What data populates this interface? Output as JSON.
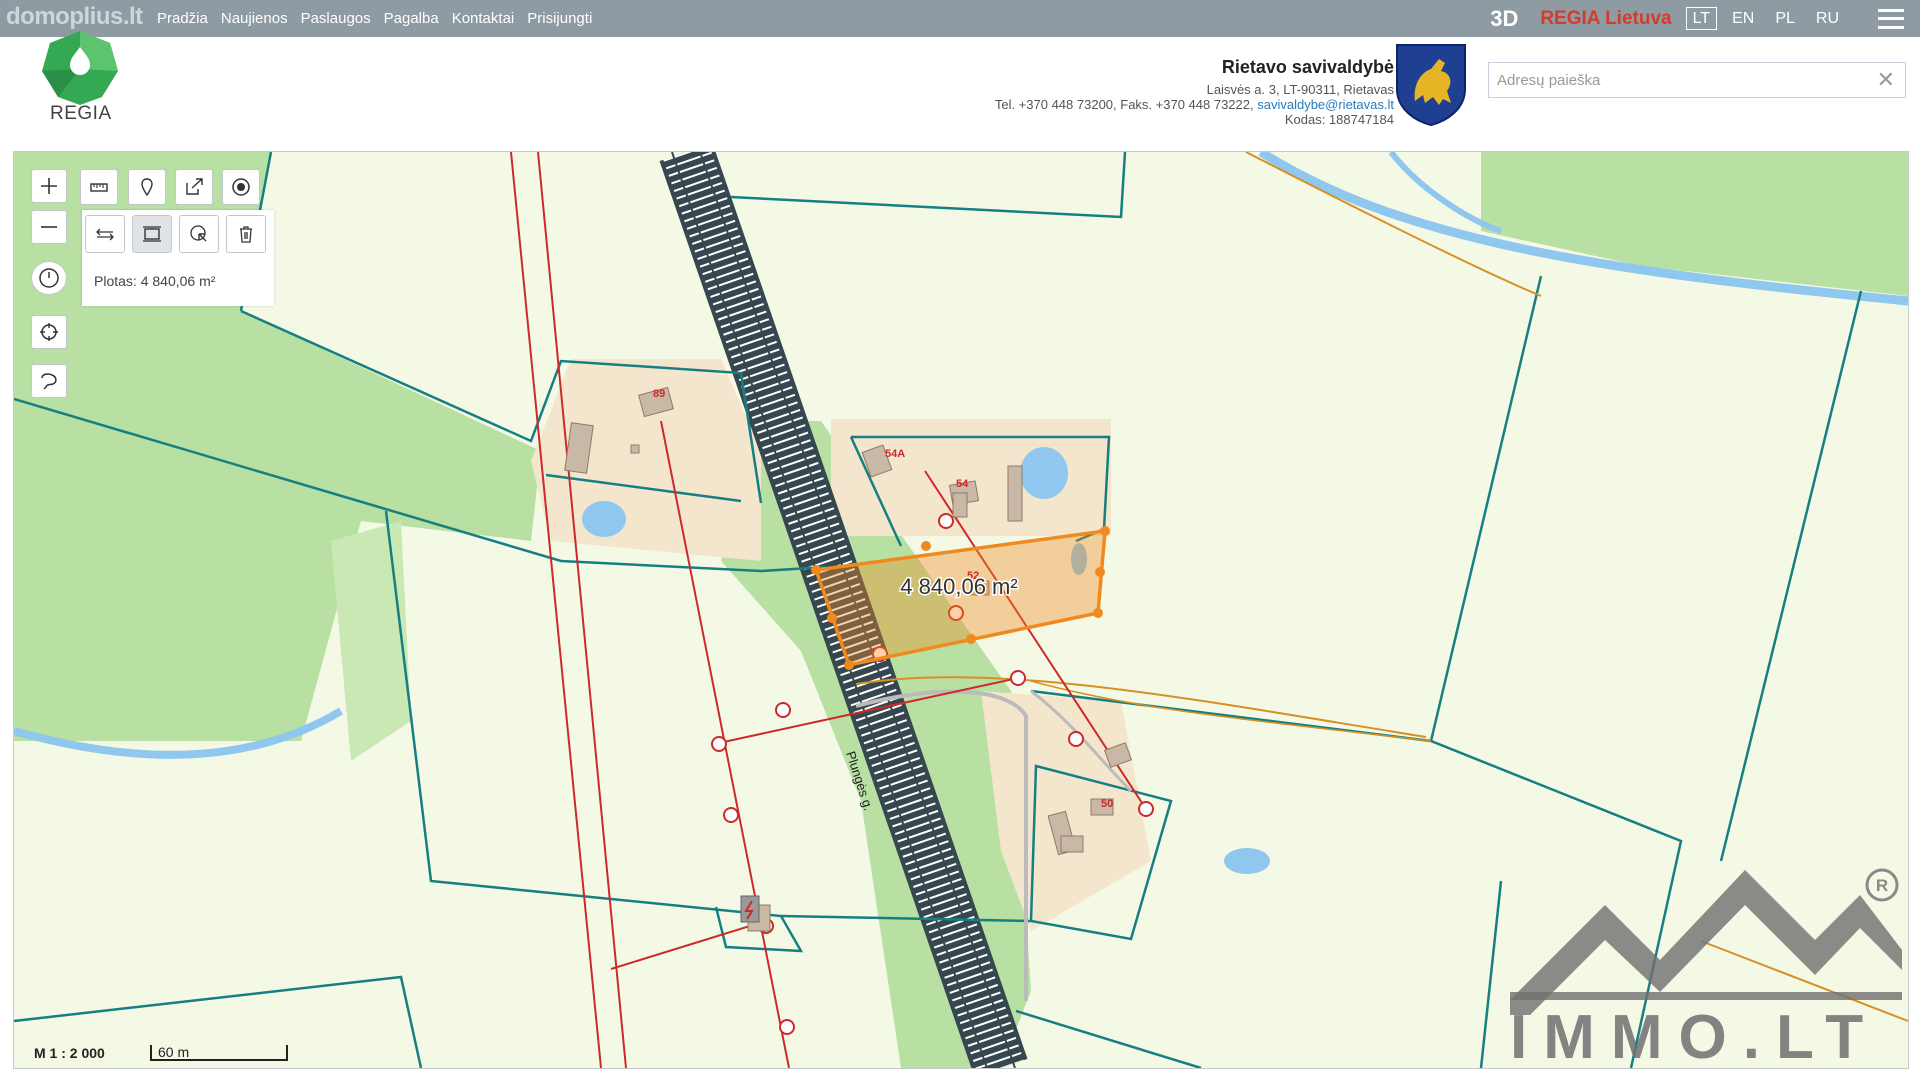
{
  "watermark": "domoplius.lt",
  "nav": {
    "items": [
      "Pradžia",
      "Naujienos",
      "Paslaugos",
      "Pagalba",
      "Kontaktai",
      "Prisijungti"
    ],
    "btn3d": "3D",
    "regia_lietuva": "REGIA Lietuva",
    "langs": [
      "LT",
      "EN",
      "PL",
      "RU"
    ],
    "active_lang": "LT"
  },
  "header": {
    "logo_text": "REGIA",
    "municipality": "Rietavo savivaldybė",
    "address": "Laisvės a. 3, LT-90311, Rietavas",
    "phone_fax": "Tel. +370 448 73200, Faks. +370 448 73222,",
    "email": "savivaldybe@rietavas.lt",
    "code": "Kodas: 188747184"
  },
  "search": {
    "placeholder": "Adresų paieška",
    "value": "",
    "clear_icon": "close-icon"
  },
  "map": {
    "tools": {
      "zoom_in": "plus-icon",
      "zoom_out": "minus-icon",
      "history": "clock-icon",
      "locate": "crosshair-icon",
      "lasso": "lasso-icon",
      "measure_ruler": "ruler-icon",
      "marker": "marker-icon",
      "share": "share-icon",
      "record": "record-icon",
      "measure_distance": "distance-icon",
      "measure_area": "area-icon",
      "pointer": "pointer-icon",
      "delete": "trash-icon"
    },
    "area_readout": "Plotas: 4 840,06 m²",
    "polygon_label": "4 840,06 m²",
    "parcel_labels": [
      "89",
      "54A",
      "54",
      "52",
      "50"
    ],
    "road_label": "Plungės g.",
    "scale_ratio": "M 1 : 2 000",
    "scale_bar": "60 m",
    "colors": {
      "field": "#f4f9e6",
      "forest": "#b8e0a3",
      "parcel": "#167f82",
      "polygon": "#f08a1f",
      "water": "#8fc7ee",
      "powerline": "#cc2a2a"
    }
  },
  "brand_watermark": "IMMO.LT"
}
